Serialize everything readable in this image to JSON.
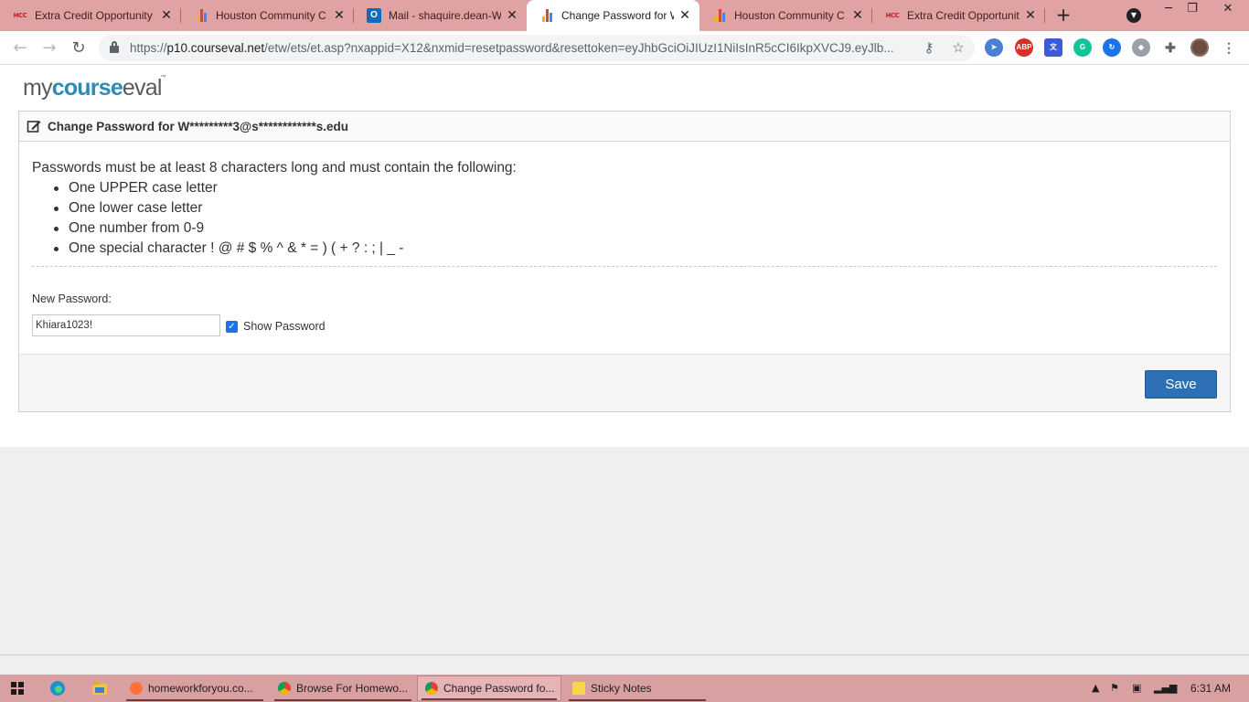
{
  "browser": {
    "tabs": [
      {
        "title": "Extra Credit Opportunity",
        "favicon": "hcc-icon",
        "active": false
      },
      {
        "title": "Houston Community C",
        "favicon": "bar-chart-icon",
        "active": false
      },
      {
        "title": "Mail - shaquire.dean-W",
        "favicon": "outlook-icon",
        "active": false
      },
      {
        "title": "Change Password for W",
        "favicon": "bar-chart-icon",
        "active": true
      },
      {
        "title": "Houston Community C",
        "favicon": "bar-chart-icon",
        "active": false
      },
      {
        "title": "Extra Credit Opportunity",
        "favicon": "hcc-icon",
        "active": false
      }
    ],
    "url_prefix": "https://",
    "url_domain": "p10.courseval.net",
    "url_path": "/etw/ets/et.asp?nxappid=X12&nxmid=resetpassword&resettoken=eyJhbGciOiJIUzI1NiIsInR5cCI6IkpXVCJ9.eyJlb...",
    "extensions": [
      "abp-icon"
    ],
    "abp_label": "ABP"
  },
  "site": {
    "logo_part1": "my",
    "logo_part2": "course",
    "logo_part3": "eval",
    "logo_tm": "™",
    "brand_color": "#2a8ab8"
  },
  "form": {
    "title": "Change Password for W*********3@s************s.edu",
    "requirements_intro": "Passwords must be at least 8 characters long and must contain the following:",
    "requirements": [
      "One UPPER case letter",
      "One lower case letter",
      "One number from 0-9",
      "One special character  ! @ # $ % ^ & * = ) ( + ? : ; | _ -"
    ],
    "new_password_label": "New Password:",
    "new_password_value": "Khiara1023!",
    "show_password_label": "Show Password",
    "show_password_checked": true,
    "save_label": "Save",
    "save_color": "#2e70b6"
  },
  "taskbar": {
    "items": [
      {
        "label": "homeworkforyou.co...",
        "icon": "firefox-icon",
        "active": false
      },
      {
        "label": "Browse For Homewo...",
        "icon": "chrome-icon",
        "active": false
      },
      {
        "label": "Change Password fo...",
        "icon": "chrome-icon",
        "active": true
      },
      {
        "label": "Sticky Notes",
        "icon": "sticky-notes-icon",
        "active": false
      }
    ],
    "time": "6:31 AM",
    "accent": "#d9a0a2"
  }
}
